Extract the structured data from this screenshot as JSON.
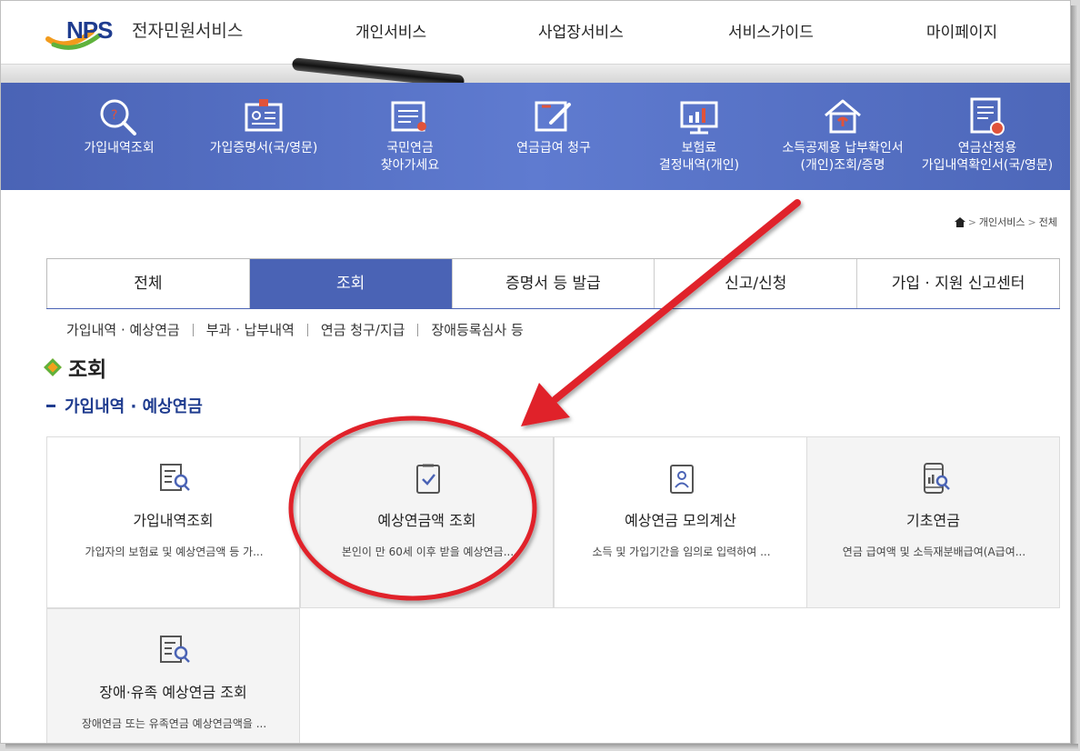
{
  "header": {
    "logo_text": "NPS",
    "logo_sub": "전자민원서비스",
    "nav": [
      "개인서비스",
      "사업장서비스",
      "서비스가이드",
      "마이페이지"
    ]
  },
  "quick_menu": [
    {
      "label": "가입내역조회",
      "icon": "magnifier-icon"
    },
    {
      "label": "가입증명서(국/영문)",
      "icon": "id-card-icon"
    },
    {
      "label": "국민연금\n찾아가세요",
      "icon": "document-list-icon"
    },
    {
      "label": "연금급여 청구",
      "icon": "pen-form-icon"
    },
    {
      "label": "보험료\n결정내역(개인)",
      "icon": "monitor-chart-icon"
    },
    {
      "label": "소득공제용 납부확인서\n(개인)조회/증명",
      "icon": "house-icon"
    },
    {
      "label": "연금산정용\n가입내역확인서(국/영문)",
      "icon": "certificate-icon"
    }
  ],
  "breadcrumb": {
    "home_icon": "home-icon",
    "items": [
      "개인서비스",
      "전체"
    ]
  },
  "tabs": [
    "전체",
    "조회",
    "증명서 등 발급",
    "신고/신청",
    "가입 · 지원 신고센터"
  ],
  "active_tab": "조회",
  "subnav": [
    "가입내역 · 예상연금",
    "부과 · 납부내역",
    "연금 청구/지급",
    "장애등록심사 등"
  ],
  "section_title": "조회",
  "subsection_title": "가입내역 · 예상연금",
  "cards": [
    {
      "title": "가입내역조회",
      "desc": "가입자의 보험료 및 예상연금액 등 가...",
      "icon": "document-search-icon"
    },
    {
      "title": "예상연금액 조회",
      "desc": "본인이 만 60세 이후 받을 예상연금...",
      "icon": "clipboard-check-icon"
    },
    {
      "title": "예상연금 모의계산",
      "desc": "소득 및 가입기간을 임의로 입력하여 ...",
      "icon": "person-card-icon"
    },
    {
      "title": "기초연금",
      "desc": "연금 급여액 및 소득재분배급여(A급여...",
      "icon": "phone-chart-icon"
    },
    {
      "title": "장애·유족 예상연금 조회",
      "desc": "장애연금 또는 유족연금 예상연금액을 ...",
      "icon": "document-search-icon"
    }
  ],
  "annotation": {
    "arrow_color": "#e0202a",
    "circle_color": "#e0202a",
    "highlighted_card": "예상연금액 조회"
  },
  "colors": {
    "brand_blue": "#4a63b5",
    "navy": "#1f3c8f"
  }
}
